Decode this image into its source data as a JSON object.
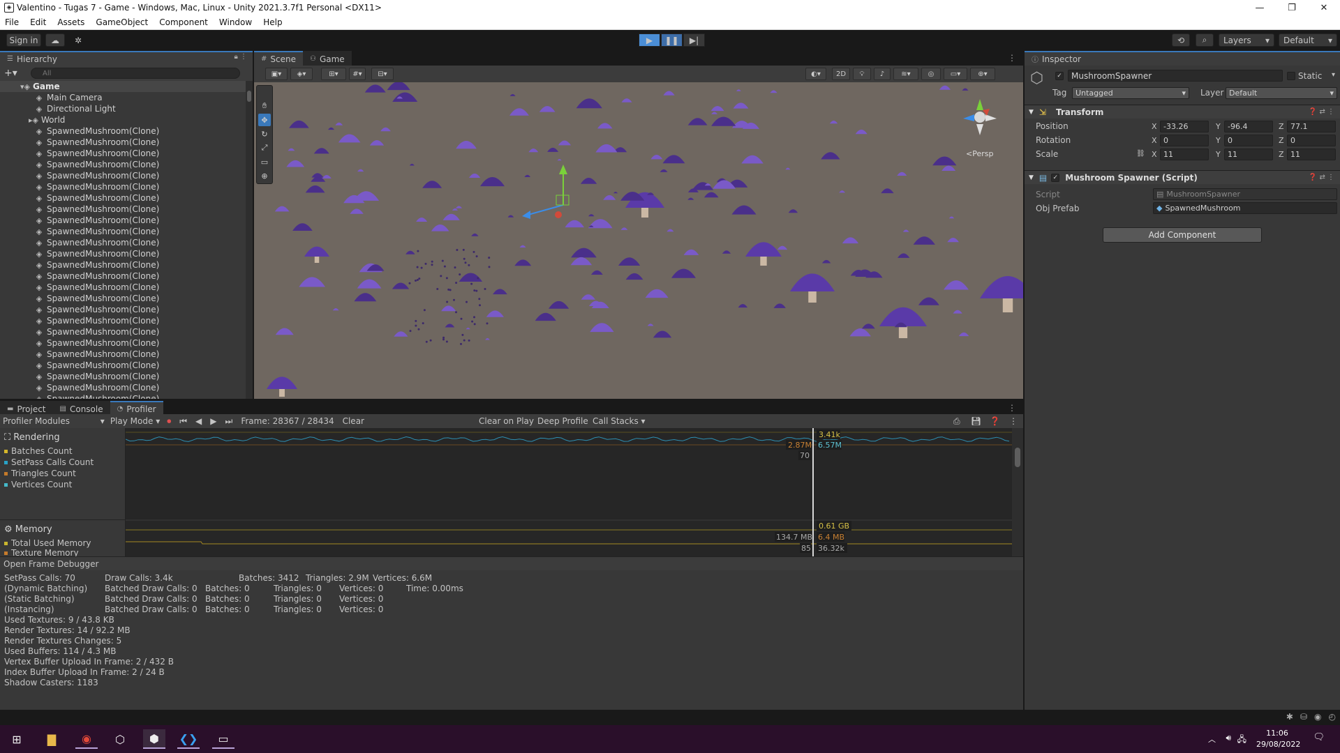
{
  "window": {
    "title": "Valentino - Tugas 7 - Game - Windows, Mac, Linux - Unity 2021.3.7f1 Personal <DX11>",
    "controls": [
      "minimize",
      "maximize",
      "close"
    ]
  },
  "menu": [
    "File",
    "Edit",
    "Assets",
    "GameObject",
    "Component",
    "Window",
    "Help"
  ],
  "toolbar": {
    "sign_in": "Sign in",
    "layers": "Layers",
    "layout": "Default"
  },
  "hierarchy": {
    "tab": "Hierarchy",
    "search_placeholder": "All",
    "scene": "Game",
    "items": [
      "Main Camera",
      "Directional Light",
      "World",
      "SpawnedMushroom(Clone)",
      "SpawnedMushroom(Clone)",
      "SpawnedMushroom(Clone)",
      "SpawnedMushroom(Clone)",
      "SpawnedMushroom(Clone)",
      "SpawnedMushroom(Clone)",
      "SpawnedMushroom(Clone)",
      "SpawnedMushroom(Clone)",
      "SpawnedMushroom(Clone)",
      "SpawnedMushroom(Clone)",
      "SpawnedMushroom(Clone)",
      "SpawnedMushroom(Clone)",
      "SpawnedMushroom(Clone)",
      "SpawnedMushroom(Clone)",
      "SpawnedMushroom(Clone)",
      "SpawnedMushroom(Clone)",
      "SpawnedMushroom(Clone)",
      "SpawnedMushroom(Clone)",
      "SpawnedMushroom(Clone)",
      "SpawnedMushroom(Clone)",
      "SpawnedMushroom(Clone)",
      "SpawnedMushroom(Clone)",
      "SpawnedMushroom(Clone)",
      "SpawnedMushroom(Clone)",
      "SpawnedMushroom(Clone)",
      "SpawnedMushroom(Clone)"
    ]
  },
  "scene_panel": {
    "tabs": [
      "Scene",
      "Game"
    ],
    "btn_2d": "2D",
    "persp": "Persp"
  },
  "inspector": {
    "tab": "Inspector",
    "object_name": "MushroomSpawner",
    "static_label": "Static",
    "tag_label": "Tag",
    "tag_value": "Untagged",
    "layer_label": "Layer",
    "layer_value": "Default",
    "transform": {
      "title": "Transform",
      "position_label": "Position",
      "rotation_label": "Rotation",
      "scale_label": "Scale",
      "position": {
        "x": "-33.26",
        "y": "-96.4",
        "z": "77.1"
      },
      "rotation": {
        "x": "0",
        "y": "0",
        "z": "0"
      },
      "scale": {
        "x": "11",
        "y": "11",
        "z": "11"
      }
    },
    "script_comp": {
      "title": "Mushroom Spawner (Script)",
      "script_label": "Script",
      "script_value": "MushroomSpawner",
      "prefab_label": "Obj Prefab",
      "prefab_value": "SpawnedMushroom"
    },
    "add_component": "Add Component"
  },
  "profiler": {
    "tabs": [
      "Project",
      "Console",
      "Profiler"
    ],
    "modules_label": "Profiler Modules",
    "play_mode": "Play Mode",
    "frame": "Frame: 28367 / 28434",
    "clear": "Clear",
    "clear_on_play": "Clear on Play",
    "deep_profile": "Deep Profile",
    "call_stacks": "Call Stacks",
    "rendering": {
      "title": "Rendering",
      "items": [
        "Batches Count",
        "SetPass Calls Count",
        "Triangles Count",
        "Vertices Count"
      ],
      "colors": [
        "#d6b72b",
        "#29a3c7",
        "#c47a2a",
        "#45b9c9"
      ],
      "markers": {
        "top": "3.41k",
        "left": "2.87M",
        "right": "6.57M",
        "low": "70"
      }
    },
    "memory": {
      "title": "Memory",
      "items": [
        "Total Used Memory",
        "Texture Memory"
      ],
      "colors": [
        "#c9b62e",
        "#c67b2c"
      ],
      "markers": {
        "top": "0.61 GB",
        "left": "134.7 MB",
        "right": "6.4 MB",
        "low": "85",
        "low_right": "36.32k"
      }
    },
    "open_frame_debugger": "Open Frame Debugger",
    "details": {
      "setpass": "SetPass Calls: 70",
      "draw_calls": "Draw Calls: 3.4k",
      "batches": "Batches: 3412",
      "triangles": "Triangles: 2.9M",
      "vertices": "Vertices: 6.6M",
      "rows": [
        {
          "name": "(Dynamic Batching)",
          "bdc": "Batched Draw Calls: 0",
          "b": "Batches: 0",
          "t": "Triangles: 0",
          "v": "Vertices: 0",
          "time": "Time: 0.00ms"
        },
        {
          "name": "(Static Batching)",
          "bdc": "Batched Draw Calls: 0",
          "b": "Batches: 0",
          "t": "Triangles: 0",
          "v": "Vertices: 0",
          "time": ""
        },
        {
          "name": "(Instancing)",
          "bdc": "Batched Draw Calls: 0",
          "b": "Batches: 0",
          "t": "Triangles: 0",
          "v": "Vertices: 0",
          "time": ""
        }
      ],
      "lines": [
        "Used Textures: 9 / 43.8 KB",
        "Render Textures: 14 / 92.2 MB",
        "Render Textures Changes: 5",
        "Used Buffers: 114 / 4.3 MB",
        "Vertex Buffer Upload In Frame: 2 / 432 B",
        "Index Buffer Upload In Frame: 2 / 24 B",
        "Shadow Casters: 1183"
      ]
    }
  },
  "taskbar": {
    "time": "11:06",
    "date": "29/08/2022"
  }
}
